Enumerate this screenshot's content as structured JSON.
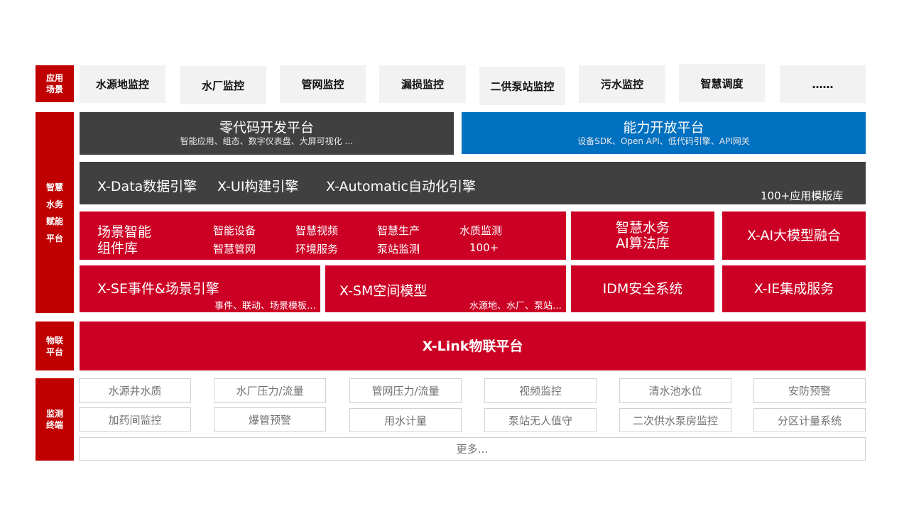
{
  "side_labels": {
    "app_scene": "应用\n场景",
    "platform": "智慧\n水务\n赋能\n平台",
    "iot": "物联\n平台",
    "terminal": "监测\n终端"
  },
  "app_scenes": [
    "水源地监控",
    "水厂监控",
    "管网监控",
    "漏损监控",
    "二供泵站监控",
    "污水监控",
    "智慧调度",
    "……"
  ],
  "lowcode": {
    "title": "零代码开发平台",
    "subtitle": "智能应用、组态、数字仪表盘、大屏可视化 …"
  },
  "open_platform": {
    "title": "能力开放平台",
    "subtitle": "设备SDK、Open API、低代码引擎、API网关"
  },
  "engines": {
    "data": "X-Data数据引擎",
    "ui": "X-UI构建引擎",
    "automatic": "X-Automatic自动化引擎",
    "template": "100+应用模版库"
  },
  "component_lib": {
    "title_line1": "场景智能",
    "title_line2": "组件库",
    "items": [
      "智能设备",
      "智慧视频",
      "智慧生产",
      "水质监测",
      "智慧管网",
      "环境服务",
      "泵站监测",
      "100+"
    ]
  },
  "ai_algo": {
    "line1": "智慧水务",
    "line2": "AI算法库"
  },
  "ai_model": "X-AI大模型融合",
  "se_engine": {
    "title": "X-SE事件&场景引擎",
    "subtitle": "事件、联动、场景模板…"
  },
  "sm_model": {
    "title": "X-SM空间模型",
    "subtitle": "水源地、水厂、泵站…"
  },
  "idm": "IDM安全系统",
  "ie": "X-IE集成服务",
  "xlink": "X-Link物联平台",
  "terminals_row1": [
    "水源井水质",
    "水厂压力/流量",
    "管网压力/流量",
    "视频监控",
    "清水池水位",
    "安防预警"
  ],
  "terminals_row2": [
    "加药间监控",
    "爆管预警",
    "用水计量",
    "泵站无人值守",
    "二次供水泵房监控",
    "分区计量系统"
  ],
  "terminal_more": "更多…",
  "colors": {
    "red": "#cc0025",
    "label_red": "#c00000",
    "dark": "#404040",
    "blue": "#0070c0",
    "light": "#f2f2f2"
  }
}
